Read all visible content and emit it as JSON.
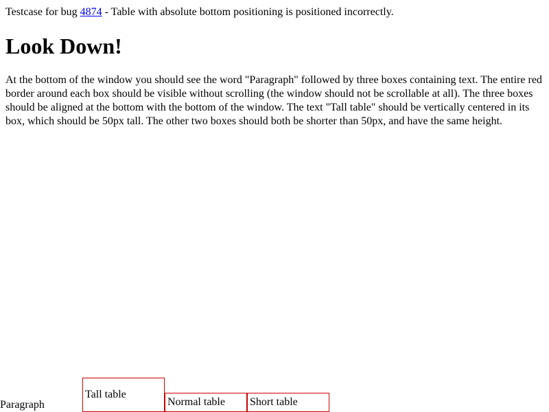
{
  "intro": {
    "prefix": "Testcase for bug ",
    "bug_link": "4874",
    "suffix": " - Table with absolute bottom positioning is positioned incorrectly."
  },
  "heading": "Look Down!",
  "description": "At the bottom of the window you should see the word \"Paragraph\" followed by three boxes containing text. The entire red border around each box should be visible without scrolling (the window should not be scrollable at all). The three boxes should be aligned at the bottom with the bottom of the window. The text \"Tall table\" should be vertically centered in its box, which should be 50px tall. The other two boxes should both be shorter than 50px, and have the same height.",
  "bottom": {
    "paragraph_word": "Paragraph",
    "tall_table": "Tall table",
    "normal_table": "Normal table",
    "short_table": "Short table"
  },
  "colors": {
    "box_border": "#cc0000",
    "link": "#0000ee"
  }
}
